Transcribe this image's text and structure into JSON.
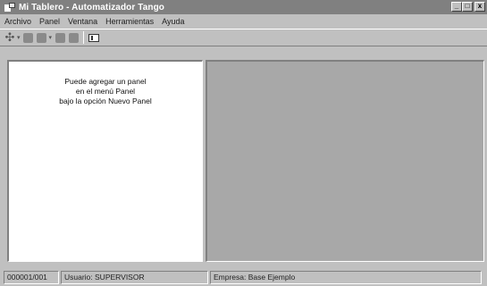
{
  "window": {
    "title": "Mi Tablero - Automatizador Tango",
    "minimize": "_",
    "maximize": "□",
    "close": "x"
  },
  "menu": [
    {
      "label": "Archivo"
    },
    {
      "label": "Panel"
    },
    {
      "label": "Ventana"
    },
    {
      "label": "Herramientas"
    },
    {
      "label": "Ayuda"
    }
  ],
  "toolbar": {
    "icons": [
      "add-panel-icon",
      "dropdown-icon",
      "panel-icon",
      "panel-icon",
      "dropdown-icon",
      "panel-icon",
      "panel-icon",
      "window-icon"
    ]
  },
  "left_panel": {
    "hint_lines": [
      "Puede agregar un panel",
      "en el menú Panel",
      "bajo la opción Nuevo Panel"
    ]
  },
  "status": {
    "code": "000001/001",
    "user": "Usuario: SUPERVISOR",
    "company": "Empresa: Base Ejemplo"
  },
  "colors": {
    "title_bar": "#808080",
    "chrome": "#c0c0c0",
    "workspace": "#a8a8a8"
  }
}
